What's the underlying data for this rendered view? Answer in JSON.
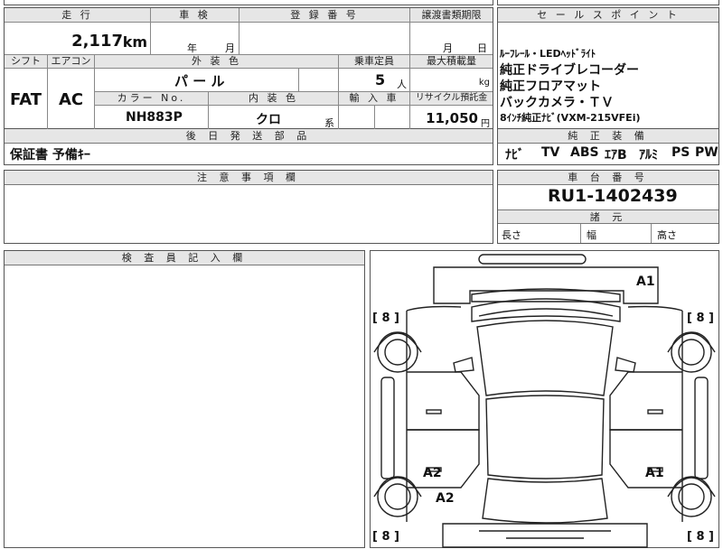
{
  "top": {
    "mileage_label": "走 行",
    "mileage_value": "2,117",
    "mileage_unit": "km",
    "inspection_label": "車 検",
    "inspection_year": "年",
    "inspection_month": "月",
    "registration_label": "登 録 番 号",
    "transfer_label": "譲渡書類期限",
    "transfer_month": "月",
    "transfer_day": "日"
  },
  "row2": {
    "shift_label": "シフト",
    "shift_value": "FAT",
    "ac_label": "エアコン",
    "ac_value": "AC",
    "exterior_label": "外 装 色",
    "exterior_value": "パ ー ル",
    "capacity_label": "乗車定員",
    "capacity_value": "5",
    "capacity_unit": "人",
    "maxload_label": "最大積載量",
    "maxload_unit": "kg",
    "color_no_label": "カラー No.",
    "color_no_value": "NH883P",
    "interior_label": "内 装 色",
    "interior_value": "クロ",
    "interior_suffix": "系",
    "import_label": "輸 入 車",
    "recycle_label": "リサイクル預託金",
    "recycle_value": "11,050",
    "recycle_unit": "円"
  },
  "sales": {
    "label": "セ ー ル ス ポ イ ン ト",
    "lines": [
      "ﾙｰﾌﾚｰﾙ・LEDﾍｯﾄﾞﾗｲﾄ",
      "純正ドライブレコーダー",
      "純正フロアマット",
      "バックカメラ・ＴＶ",
      "8ｲﾝﾁ純正ﾅﾋﾞ(VXM-215VFEi)"
    ]
  },
  "later": {
    "label": "後 日 発 送 部 品",
    "value": "保証書 予備ｷｰ"
  },
  "equipment": {
    "label": "純 正 装 備",
    "items": [
      "ﾅﾋﾞ",
      "TV",
      "ABS",
      "ｴｱB",
      "ｱﾙﾐ",
      "PS",
      "PW"
    ]
  },
  "notes": {
    "label": "注 意 事 項 欄"
  },
  "chassis": {
    "label": "車 台 番 号",
    "value": "RU1-1402439"
  },
  "dims": {
    "label": "諸 元",
    "length": "長さ",
    "width": "幅",
    "height": "高さ"
  },
  "inspector": {
    "label": "検 査 員 記 入 欄"
  },
  "diagram": {
    "marks": {
      "front_right": "A1",
      "left_mid": "A2",
      "right_mid": "A1",
      "left_lower": "A2"
    },
    "tire": "[ 8 ]"
  }
}
